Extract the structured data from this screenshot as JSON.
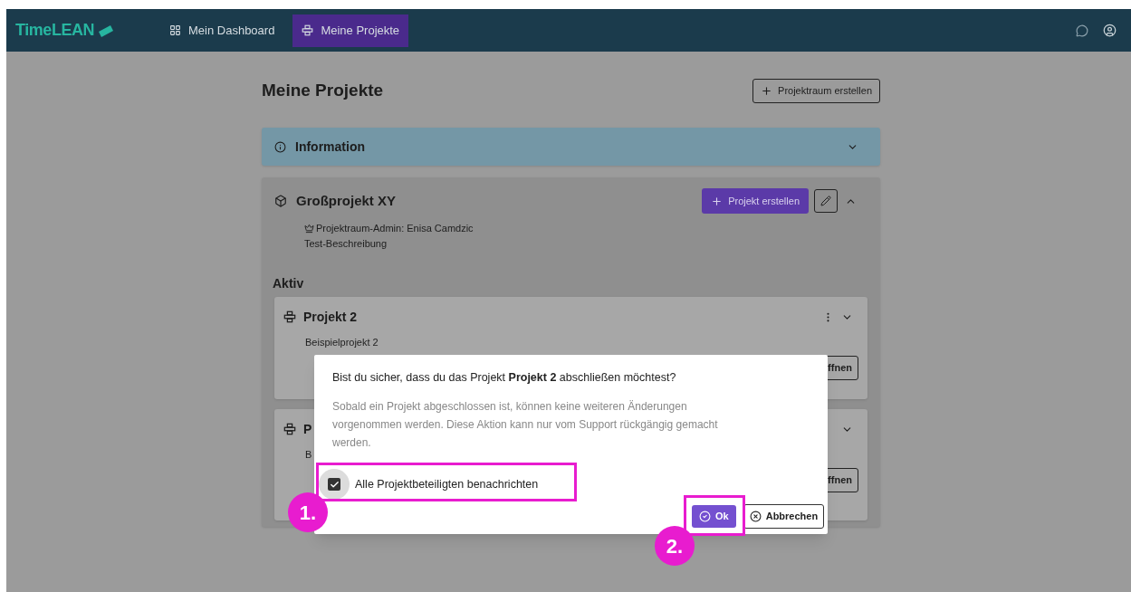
{
  "navbar": {
    "logo": "TimeLEAN",
    "items": [
      {
        "label": "Mein Dashboard",
        "kind": "dashboard",
        "selected": false
      },
      {
        "label": "Meine Projekte",
        "kind": "projects",
        "selected": true
      }
    ]
  },
  "page": {
    "title": "Meine Projekte",
    "create_button": "Projektraum erstellen"
  },
  "information": {
    "title": "Information",
    "expanded": false
  },
  "project_space": {
    "title": "Großprojekt XY",
    "expanded": true,
    "create_button": "Projekt erstellen",
    "admin": "Projektraum-Admin: Enisa Camdzic",
    "description": "Test-Beschreibung",
    "section": "Aktiv",
    "projects": [
      {
        "title": "Projekt 2",
        "description": "Beispielprojekt 2",
        "button": "ffnen",
        "expanded": false,
        "menu": true
      },
      {
        "title": "P",
        "description": "B",
        "button": "ffnen",
        "expanded": false,
        "menu": false
      }
    ]
  },
  "dialog": {
    "title": "Bist du sicher, dass du das Projekt **Projekt 2** abschließen möchtest?",
    "body": "Sobald ein Projekt abgeschlossen ist, können keine weiteren Änderungen vorgenommen werden. Diese Aktion kann nur vom Support rückgängig gemacht werden.",
    "checkbox": {
      "label": "Alle Projektbeteiligten benachrichten",
      "checked": true
    },
    "ok_button": "Ok",
    "cancel_button": "Abbrechen"
  },
  "annotations": [
    {
      "label": "1."
    },
    {
      "label": "2."
    }
  ]
}
